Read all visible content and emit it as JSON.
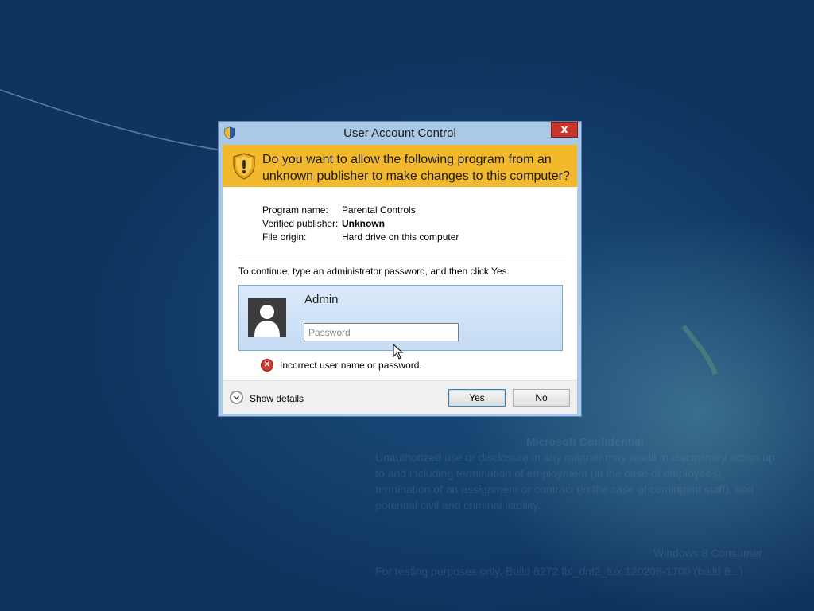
{
  "dialog": {
    "title": "User Account Control",
    "close_label": "x",
    "banner_text": "Do you want to allow the following program from an unknown publisher to make changes to this computer?",
    "program_info": [
      {
        "label": "Program name:",
        "value": "Parental Controls",
        "bold": false
      },
      {
        "label": "Verified publisher:",
        "value": "Unknown",
        "bold": true
      },
      {
        "label": "File origin:",
        "value": "Hard drive on this computer",
        "bold": false
      }
    ],
    "instruction": "To continue, type an administrator password, and then click Yes.",
    "credential": {
      "username": "Admin",
      "password_placeholder": "Password",
      "password_value": ""
    },
    "error_text": "Incorrect user name or password.",
    "show_details_label": "Show details",
    "yes_label": "Yes",
    "no_label": "No"
  },
  "desktop_watermark": {
    "title": "Microsoft Confidential",
    "body_lines": [
      "Unauthorized use or disclosure in any manner may result in disciplinary action up",
      "to and including termination of employment (in the case of employees),",
      "termination of an assignment or contract (in the case of contingent staff), and",
      "potential civil and criminal liability."
    ],
    "edition": "Windows 8 Consumer",
    "build": "For testing purposes only. Build 8272.fbl_dnt2_tux.120208-1700 (build 8...)"
  },
  "icons": {
    "title_icon": "uac-shield-icon",
    "banner_icon": "warning-shield-icon",
    "error_icon": "error-x-icon",
    "details_icon": "chevron-down-icon",
    "avatar_icon": "user-avatar-icon"
  },
  "colors": {
    "banner": "#f3b92d",
    "close_button": "#c7352b",
    "dialog_frame": "#a9c9e6",
    "desktop": "#0f3460"
  }
}
